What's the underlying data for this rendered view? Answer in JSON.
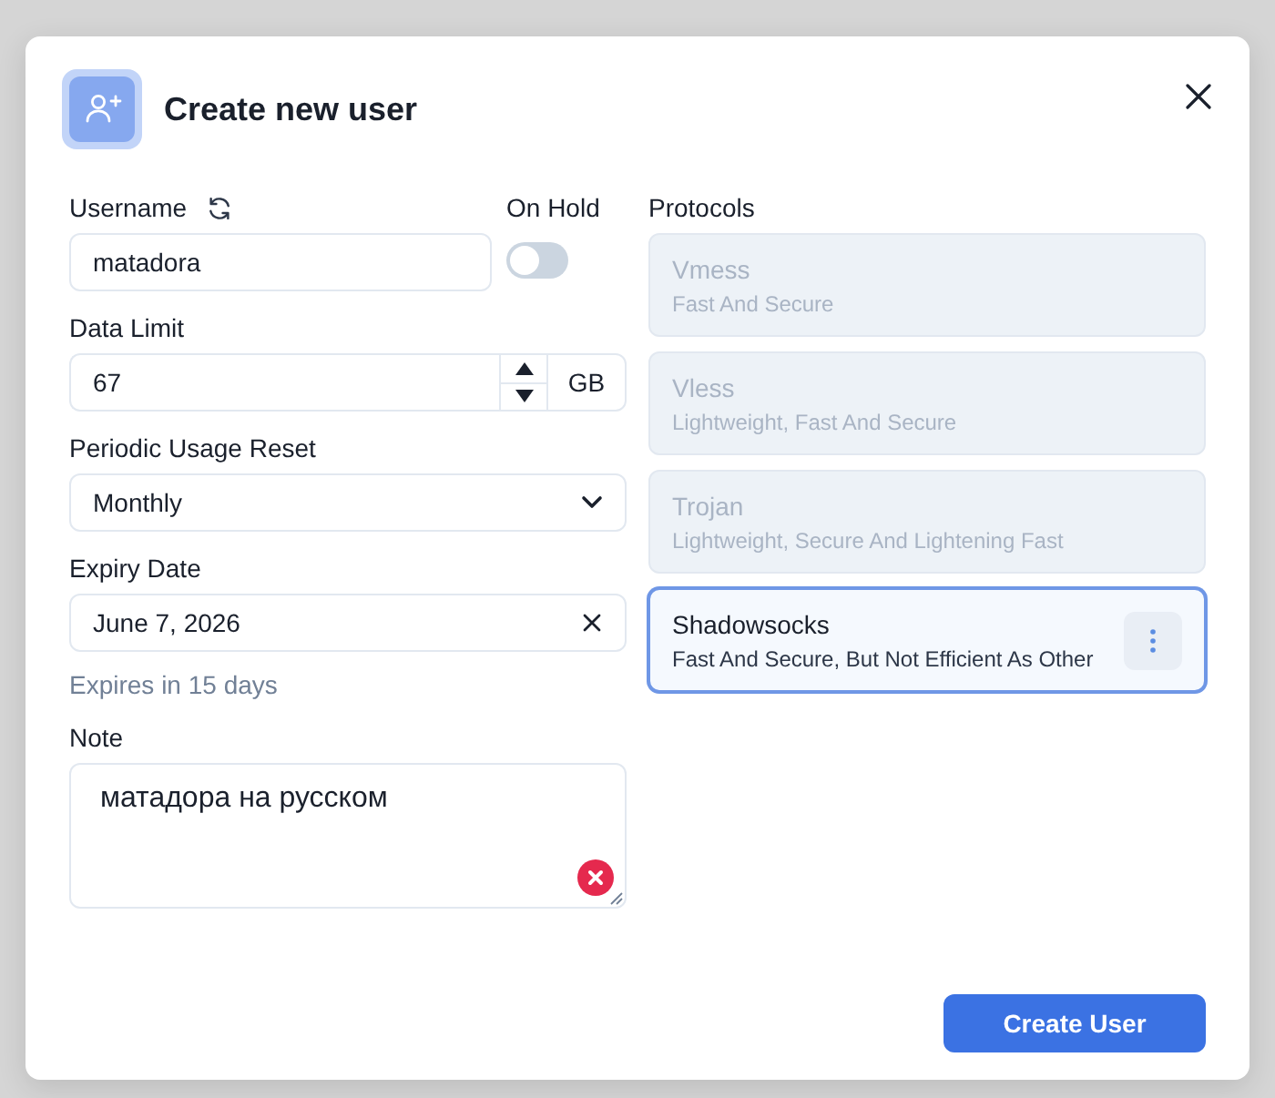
{
  "dialog": {
    "title": "Create new user"
  },
  "form": {
    "username": {
      "label": "Username",
      "value": "matadora"
    },
    "on_hold": {
      "label": "On Hold",
      "on": false
    },
    "data_limit": {
      "label": "Data Limit",
      "value": "67",
      "unit": "GB"
    },
    "periodic_usage_reset": {
      "label": "Periodic Usage Reset",
      "value": "Monthly"
    },
    "expiry_date": {
      "label": "Expiry Date",
      "value": "June 7, 2026",
      "hint": "Expires in 15 days"
    },
    "note": {
      "label": "Note",
      "value": "матадора на русском"
    }
  },
  "protocols": {
    "label": "Protocols",
    "items": [
      {
        "name": "Vmess",
        "description": "Fast And Secure",
        "selected": false
      },
      {
        "name": "Vless",
        "description": "Lightweight, Fast And Secure",
        "selected": false
      },
      {
        "name": "Trojan",
        "description": "Lightweight, Secure And Lightening Fast",
        "selected": false
      },
      {
        "name": "Shadowsocks",
        "description": "Fast And Secure, But Not Efficient As Other",
        "selected": true
      }
    ]
  },
  "buttons": [
    {
      "label": "Create User"
    }
  ]
}
